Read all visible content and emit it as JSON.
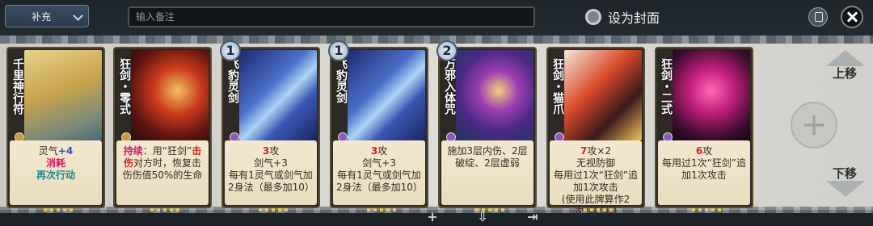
{
  "topbar": {
    "dropdown_label": "补充",
    "remark_placeholder": "输入备注",
    "cover_label": "设为封面"
  },
  "side": {
    "up_label": "上移",
    "down_label": "下移",
    "add_label": "+"
  },
  "cards": [
    {
      "name": "千里神行符",
      "level": "",
      "desc_lines": [
        {
          "text": "灵气",
          "cls": ""
        },
        {
          "text": "+4",
          "cls": "desc-blue"
        },
        {
          "text": "\n消耗",
          "cls": "desc-pink"
        },
        {
          "text": "\n再次行动",
          "cls": "desc-teal"
        }
      ],
      "gem_color": "#c79a3c",
      "art": "talisman"
    },
    {
      "name": "狂剑・零式",
      "level": "",
      "desc_lines": [
        {
          "text": "持续",
          "cls": "desc-pink"
        },
        {
          "text": "：用“狂剑”",
          "cls": ""
        },
        {
          "text": "击伤",
          "cls": "desc-red"
        },
        {
          "text": "对方时，恢复击伤伤值50%的生命",
          "cls": ""
        }
      ],
      "gem_color": "#c79a3c",
      "art": "red"
    },
    {
      "name": "飞豹灵剑",
      "level": "1",
      "desc_lines": [
        {
          "text": "3",
          "cls": "desc-red"
        },
        {
          "text": "攻\n剑气+3\n每有1灵气或剑气加2身法（最多加10）",
          "cls": ""
        }
      ],
      "gem_color": "#8a58c8",
      "art": "sword"
    },
    {
      "name": "飞豹灵剑",
      "level": "1",
      "desc_lines": [
        {
          "text": "3",
          "cls": "desc-red"
        },
        {
          "text": "攻\n剑气+3\n每有1灵气或剑气加2身法（最多加10）",
          "cls": ""
        }
      ],
      "gem_color": "#8a58c8",
      "art": "sword"
    },
    {
      "name": "万邪入体咒",
      "level": "2",
      "desc_lines": [
        {
          "text": "施加3层内伤、2层破绽、2层虚弱",
          "cls": ""
        }
      ],
      "gem_color": "#8a58c8",
      "art": "purple"
    },
    {
      "name": "狂剑・猫爪",
      "level": "",
      "desc_lines": [
        {
          "text": "7",
          "cls": "desc-red"
        },
        {
          "text": "攻×2\n无视防御\n每用过1次“狂剑”追加1次攻击\n(使用此牌算作2次“狂剑”)",
          "cls": ""
        }
      ],
      "gem_color": "#8a58c8",
      "art": "cat"
    },
    {
      "name": "狂剑・二式",
      "level": "",
      "desc_lines": [
        {
          "text": "6",
          "cls": "desc-red"
        },
        {
          "text": "攻\n每用过1次“狂剑”追加1次攻击",
          "cls": ""
        }
      ],
      "gem_color": "#8a58c8",
      "art": "pink"
    }
  ]
}
